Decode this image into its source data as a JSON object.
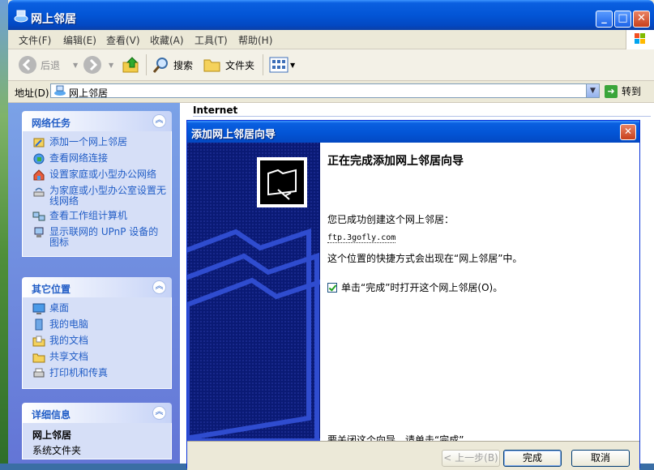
{
  "window": {
    "title": "网上邻居"
  },
  "menu": [
    "文件(F)",
    "编辑(E)",
    "查看(V)",
    "收藏(A)",
    "工具(T)",
    "帮助(H)"
  ],
  "toolbar": {
    "back": "后退",
    "search": "搜索",
    "folders": "文件夹"
  },
  "address": {
    "label": "地址(D)",
    "value": "网上邻居",
    "go": "转到"
  },
  "network_tasks": {
    "title": "网络任务",
    "items": [
      "添加一个网上邻居",
      "查看网络连接",
      "设置家庭或小型办公网络",
      "为家庭或小型办公室设置无线网络",
      "查看工作组计算机",
      "显示联网的 UPnP 设备的图标"
    ]
  },
  "other_places": {
    "title": "其它位置",
    "items": [
      "桌面",
      "我的电脑",
      "我的文档",
      "共享文档",
      "打印机和传真"
    ]
  },
  "details": {
    "title": "详细信息",
    "name": "网上邻居",
    "type": "系统文件夹"
  },
  "content": {
    "group": "Internet"
  },
  "dialog": {
    "title": "添加网上邻居向导",
    "heading": "正在完成添加网上邻居向导",
    "created": "您已成功创建这个网上邻居：",
    "link": "ftp.3gofly.com",
    "shortcut_note": "这个位置的快捷方式会出现在“网上邻居”中。",
    "checkbox": "单击“完成”时打开这个网上邻居(O)。",
    "close_note": "要关闭这个向导，请单击“完成”。",
    "buttons": {
      "back": "< 上一步(B)",
      "finish": "完成",
      "cancel": "取消"
    }
  },
  "colors": {
    "xp_blue": "#0355d6",
    "task_link": "#215dc6",
    "wizard_side": "#0a1a75"
  }
}
